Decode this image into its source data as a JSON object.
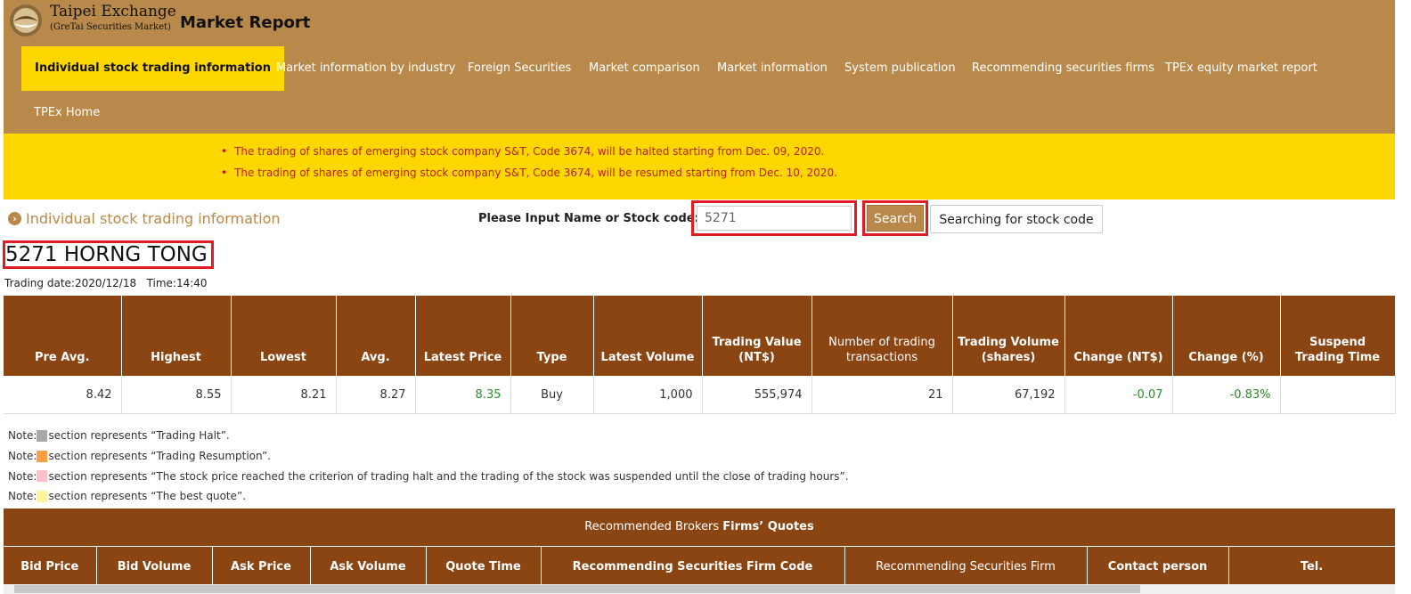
{
  "header": {
    "logo_main": "Taipei Exchange",
    "logo_sub": "(GreTai Securities Market)",
    "report_title": "Market Report"
  },
  "nav": [
    {
      "label": "Individual stock trading information",
      "active": true
    },
    {
      "label": "Market information by industry"
    },
    {
      "label": "Foreign Securities"
    },
    {
      "label": "Market comparison"
    },
    {
      "label": "Market information"
    },
    {
      "label": "System publication"
    },
    {
      "label": "Recommending securities firms"
    },
    {
      "label": "TPEx equity market report"
    },
    {
      "label": "TPEx Home"
    }
  ],
  "announcements": [
    "The trading of shares of emerging stock company S&T, Code 3674, will be halted starting from Dec. 09, 2020.",
    "The trading of shares of emerging stock company S&T, Code 3674, will be resumed starting from Dec. 10, 2020."
  ],
  "section": {
    "title": "Individual stock trading information",
    "search_label": "Please Input Name or Stock code:",
    "search_value": "5271",
    "search_button": "Search",
    "code_button": "Searching for stock code"
  },
  "stock": {
    "name": "5271 HORNG TONG",
    "trading_date": "Trading date:2020/12/18",
    "time": "Time:14:40"
  },
  "quote_table": {
    "headers": [
      "Pre Avg.",
      "Highest",
      "Lowest",
      "Avg.",
      "Latest Price",
      "Type",
      "Latest Volume",
      "Trading Value (NT$)",
      "Number of trading transactions",
      "Trading Volume (shares)",
      "Change (NT$)",
      "Change (%)",
      "Suspend Trading Time"
    ],
    "row": [
      "8.42",
      "8.55",
      "8.21",
      "8.27",
      "8.35",
      "Buy",
      "1,000",
      "555,974",
      "21",
      "67,192",
      "-0.07",
      "-0.83%",
      ""
    ]
  },
  "notes": [
    {
      "prefix": "Note:",
      "color": "#a9a9a9",
      "text": "section represents “Trading Halt”."
    },
    {
      "prefix": "Note:",
      "color": "#ff9f43",
      "text": "section represents “Trading Resumption”."
    },
    {
      "prefix": "Note:",
      "color": "#ffc0cb",
      "text": "section represents “The stock price reached the criterion of trading halt and the trading of the stock was suspended until the close of trading hours”."
    },
    {
      "prefix": "Note:",
      "color": "#fff59d",
      "text": "section represents “The best quote”."
    }
  ],
  "brokers": {
    "title_plain": "Recommended Brokers ",
    "title_bold": "Firms’ Quotes",
    "headers": [
      "Bid Price",
      "Bid Volume",
      "Ask Price",
      "Ask Volume",
      "Quote Time",
      "Recommending Securities Firm Code",
      "Recommending Securities Firm",
      "Contact person",
      "Tel."
    ]
  },
  "colors": {
    "header_bg": "#b8894a",
    "accent_yellow": "#ffd700",
    "table_brown": "#8b4513",
    "highlight_red": "#e01b24",
    "positive_green": "#2e8b2e"
  }
}
